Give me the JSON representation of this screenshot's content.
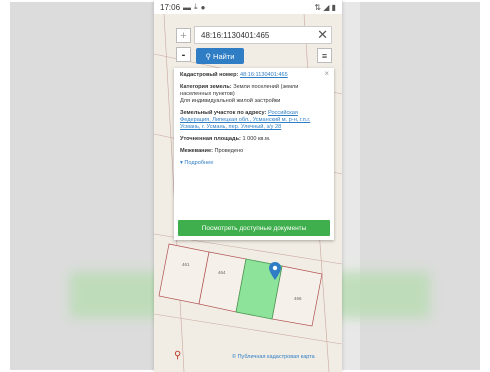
{
  "status_bar": {
    "time": "17:06",
    "right_indicators": "⇅ ◢ ▮"
  },
  "search": {
    "value": "48:16:1130401:465",
    "find_label": "Найти"
  },
  "zoom": {
    "in_label": "+",
    "out_label": "-"
  },
  "menu_label": "≡",
  "info_panel": {
    "close_label": "×",
    "cadastral_number_label": "Кадастровый номер:",
    "cadastral_number_value": "48:16:1130401:465",
    "category_label": "Категория земель:",
    "category_value": "Земли поселений (земли населенных пунктов)",
    "category_use": "Для индивидуальной жилой застройки",
    "address_label": "Земельный участок по адресу:",
    "address_value": "Российская Федерация, Липецкая обл., Усманский м. р-н, г.п.г. Усмань, г. Усмань, пер. Улечный, з/у 28",
    "area_label": "Уточненная площадь:",
    "area_value": "1 000 кв.м.",
    "survey_label": "Межевание:",
    "survey_value": "Проведено",
    "more_label": "Подробнее",
    "docs_button_label": "Посмотреть доступные документы"
  },
  "map": {
    "parcel_labels": [
      "461",
      "464",
      "466"
    ],
    "attribution": "© Публичная кадастровая карта",
    "highlight_color": "#8ee39a",
    "accent_blue": "#2f7ec5",
    "accent_green": "#3fae4c"
  }
}
